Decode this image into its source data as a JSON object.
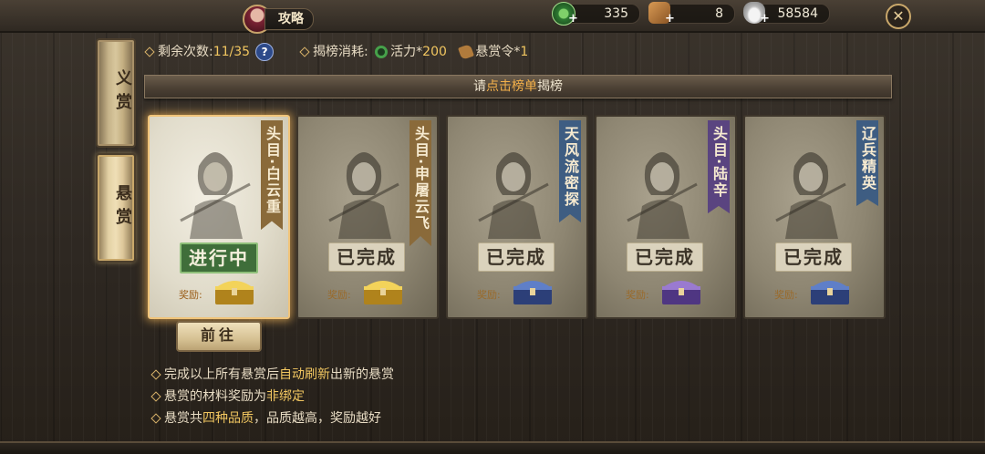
{
  "header": {
    "guide_label": "攻略",
    "resources": [
      {
        "icon": "jade-icon",
        "value": "335"
      },
      {
        "icon": "scroll-icon",
        "value": "8"
      },
      {
        "icon": "silver-ingot-icon",
        "value": "58584"
      }
    ]
  },
  "sidebar": {
    "tabs": [
      {
        "label": "义赏",
        "active": false
      },
      {
        "label": "悬赏",
        "active": true
      }
    ]
  },
  "info": {
    "remaining_label": "剩余次数:",
    "remaining_value": "11/35",
    "help_symbol": "?",
    "cost_label": "揭榜消耗:",
    "vitality_label": "活力*",
    "vitality_value": "200",
    "token_label": "悬赏令*",
    "token_value": "1"
  },
  "banner": {
    "prefix": "请",
    "highlight": "点击榜单",
    "suffix": "揭榜"
  },
  "bounties": [
    {
      "title": "头目·白云重",
      "status": "进行中",
      "reward_label": "奖励:",
      "ribbon_color": "#8a6a3a",
      "chest": "gold-chest-icon",
      "active": true
    },
    {
      "title": "头目·申屠云飞",
      "status": "已完成",
      "reward_label": "奖励:",
      "ribbon_color": "#8a6a3a",
      "chest": "gold-chest-icon",
      "active": false
    },
    {
      "title": "天风流密探",
      "status": "已完成",
      "reward_label": "奖励:",
      "ribbon_color": "#3e5d82",
      "chest": "blue-chest-icon",
      "active": false
    },
    {
      "title": "头目·陆辛",
      "status": "已完成",
      "reward_label": "奖励:",
      "ribbon_color": "#5a4480",
      "chest": "purple-chest-icon",
      "active": false
    },
    {
      "title": "辽兵精英",
      "status": "已完成",
      "reward_label": "奖励:",
      "ribbon_color": "#3e5d82",
      "chest": "blue-chest-icon",
      "active": false
    }
  ],
  "goto_button": "前往",
  "tips": [
    {
      "a": "完成以上所有悬赏后",
      "hl": "自动刷新",
      "b": "出新的悬赏"
    },
    {
      "a": "悬赏的材料奖励为",
      "hl": "非绑定",
      "b": ""
    },
    {
      "a": "悬赏共",
      "hl": "四种品质",
      "b": "，品质越高，奖励越好"
    }
  ],
  "colors": {
    "highlight": "#f1c660",
    "accent_orange": "#f3b04a",
    "active_glow": "#f0c47a"
  }
}
